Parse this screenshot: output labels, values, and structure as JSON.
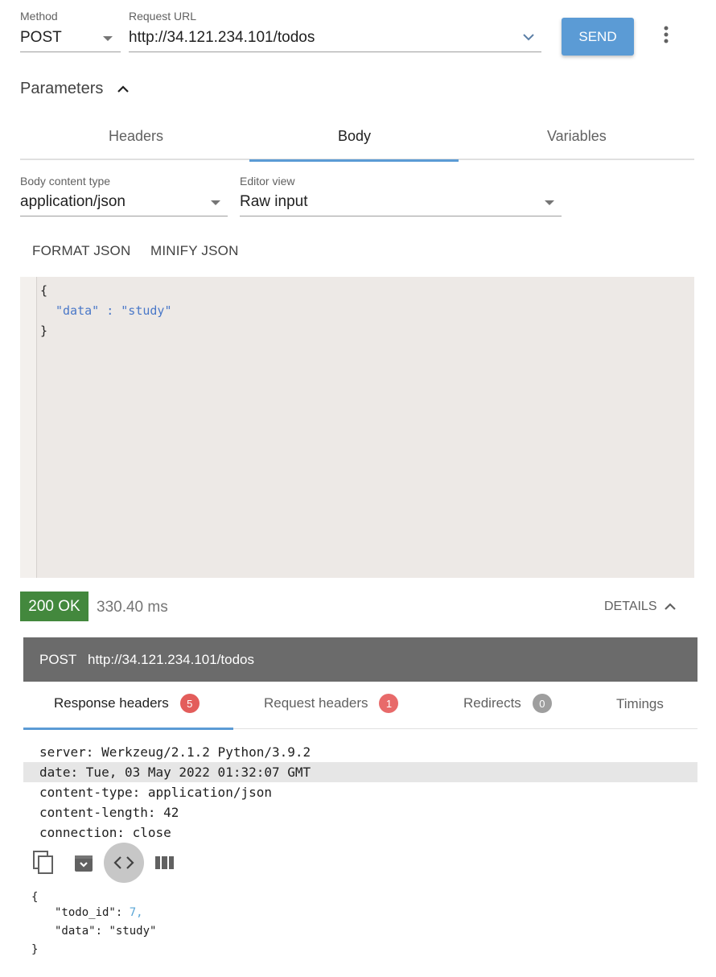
{
  "request": {
    "method_label": "Method",
    "method_value": "POST",
    "url_label": "Request URL",
    "url_value": "http://34.121.234.101/todos",
    "send_label": "SEND"
  },
  "parameters": {
    "title": "Parameters"
  },
  "tabs": [
    {
      "label": "Headers"
    },
    {
      "label": "Body"
    },
    {
      "label": "Variables"
    }
  ],
  "body_settings": {
    "content_type_label": "Body content type",
    "content_type_value": "application/json",
    "editor_view_label": "Editor view",
    "editor_view_value": "Raw input"
  },
  "actions": {
    "format_label": "FORMAT JSON",
    "minify_label": "MINIFY JSON"
  },
  "editor": {
    "open_brace": "{",
    "key": "\"data\"",
    "sep": " : ",
    "value": "\"study\"",
    "close_brace": "}"
  },
  "response": {
    "status": "200 OK",
    "time": "330.40 ms",
    "details_label": "DETAILS",
    "method": "POST",
    "url": "http://34.121.234.101/todos",
    "tabs": [
      {
        "label": "Response headers",
        "count": "5",
        "color": "#e35d5b"
      },
      {
        "label": "Request headers",
        "count": "1",
        "color": "#e86a6a"
      },
      {
        "label": "Redirects",
        "count": "0",
        "color": "#9e9e9e"
      },
      {
        "label": "Timings"
      }
    ],
    "headers": [
      "server: Werkzeug/2.1.2 Python/3.9.2",
      "date: Tue, 03 May 2022 01:32:07 GMT",
      "content-type: application/json",
      "content-length: 42",
      "connection: close"
    ],
    "body": {
      "open": "{",
      "line1_key": "\"todo_id\"",
      "line1_value": "7,",
      "line2_key": "\"data\"",
      "line2_value": "\"study\"",
      "close": "}"
    }
  },
  "colors": {
    "accent": "#5b9bd5",
    "ok": "#43883d"
  }
}
